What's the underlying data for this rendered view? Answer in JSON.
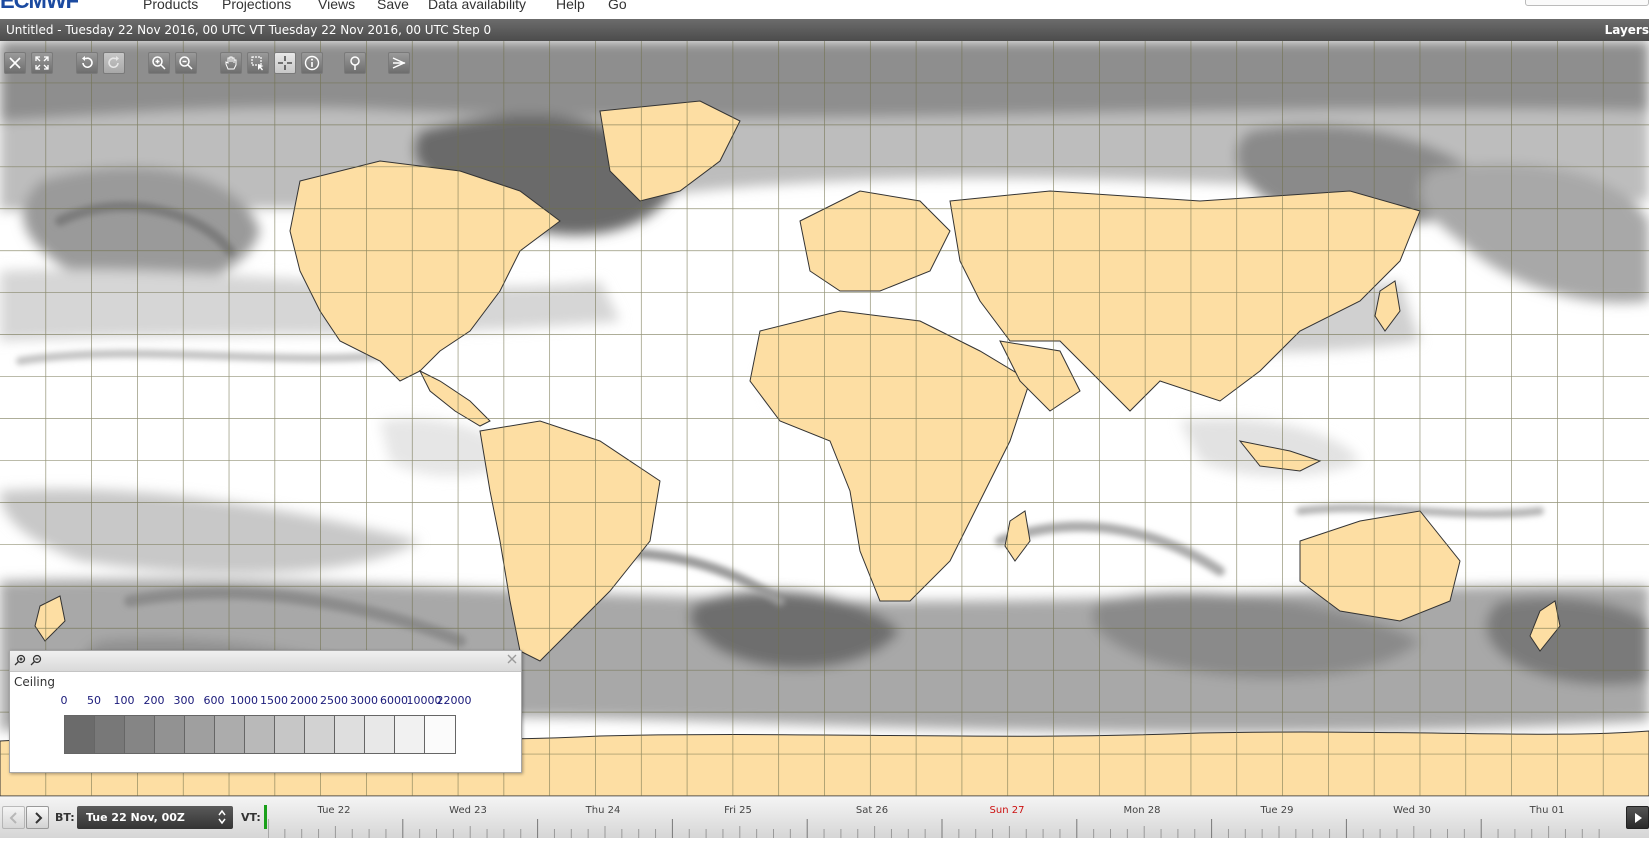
{
  "menubar": {
    "logo": "ECMWF",
    "items": [
      "Products",
      "Projections",
      "Views",
      "Save",
      "Data availability",
      "Help",
      "Go"
    ]
  },
  "titlebar": {
    "text": "Untitled - Tuesday 22 Nov 2016, 00 UTC VT Tuesday 22 Nov 2016, 00 UTC Step 0",
    "layers_label": "Layers"
  },
  "toolbar": {
    "tools": [
      {
        "name": "close-icon",
        "state": "normal"
      },
      {
        "name": "fullscreen-icon",
        "state": "normal"
      },
      {
        "name": "undo-icon",
        "state": "normal"
      },
      {
        "name": "redo-icon",
        "state": "disabled"
      },
      {
        "name": "zoom-in-icon",
        "state": "normal"
      },
      {
        "name": "zoom-out-icon",
        "state": "normal"
      },
      {
        "name": "pan-hand-icon",
        "state": "normal"
      },
      {
        "name": "zoom-box-icon",
        "state": "normal"
      },
      {
        "name": "crosshair-icon",
        "state": "active"
      },
      {
        "name": "info-icon",
        "state": "normal"
      },
      {
        "name": "point-probe-icon",
        "state": "normal"
      },
      {
        "name": "cross-section-icon",
        "state": "normal"
      }
    ]
  },
  "map": {
    "colors": {
      "ocean": "#ffffff",
      "land": "#fddea3",
      "coast": "#333333",
      "grid": "#6f6f4a",
      "cloud_light": "#e0e0e0",
      "cloud_mid": "#bdbdbd",
      "cloud_dark": "#8e8e8e",
      "cloud_darkest": "#6a6a6a"
    }
  },
  "legend": {
    "title": "Ceiling",
    "ticks": [
      "0",
      "50",
      "100",
      "200",
      "300",
      "600",
      "1000",
      "1500",
      "2000",
      "2500",
      "3000",
      "6000",
      "10000",
      "22000"
    ],
    "swatches": [
      "#6b6b6b",
      "#787878",
      "#858585",
      "#929292",
      "#9f9f9f",
      "#acacac",
      "#b9b9b9",
      "#c6c6c6",
      "#d2d2d2",
      "#dedede",
      "#e8e8e8",
      "#f1f1f1",
      "#fbfbfb"
    ]
  },
  "timeline": {
    "bt_label": "BT:",
    "bt_value": "Tue 22 Nov, 00Z",
    "vt_label": "VT:",
    "days": [
      "Tue 22",
      "Wed 23",
      "Thu 24",
      "Fri 25",
      "Sat 26",
      "Sun 27",
      "Mon 28",
      "Tue 29",
      "Wed 30",
      "Thu 01"
    ],
    "sunday_color": "#cc1111"
  }
}
